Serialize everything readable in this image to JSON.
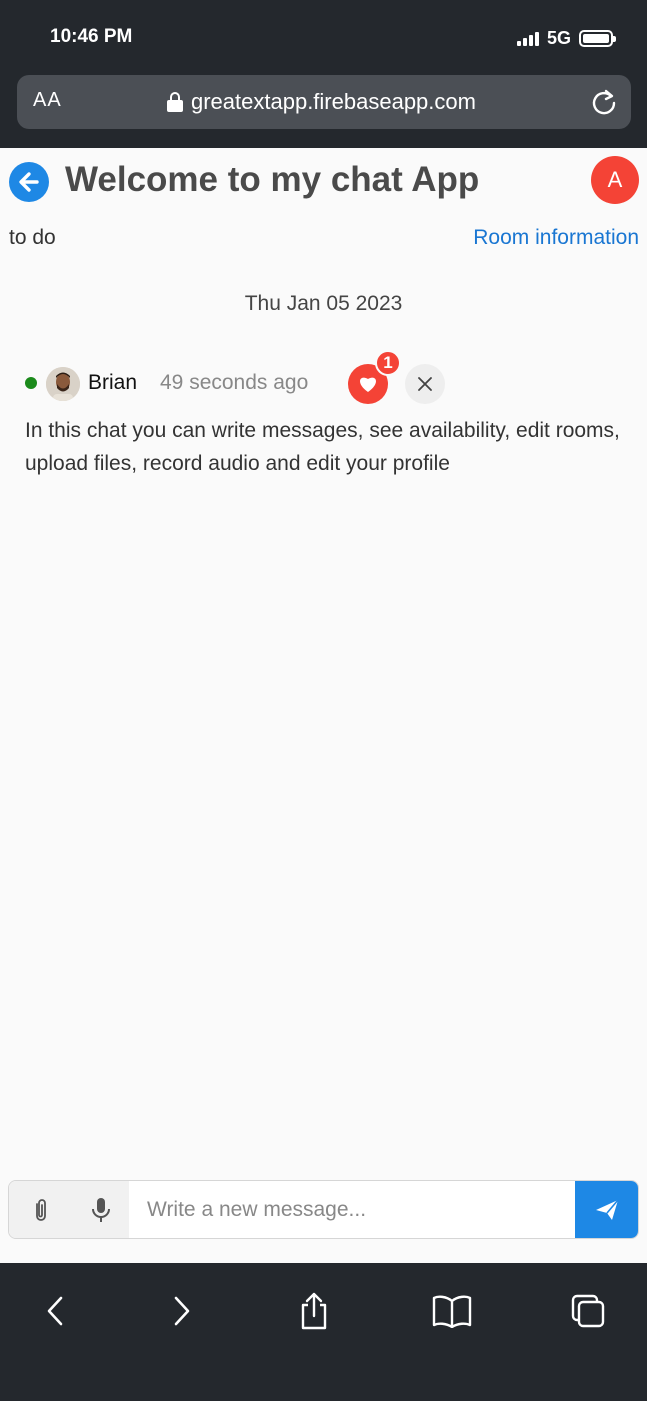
{
  "status": {
    "time": "10:46 PM",
    "network": "5G"
  },
  "browser": {
    "text_size_label": "AA",
    "url": "greatextapp.firebaseapp.com"
  },
  "header": {
    "title": "Welcome to my chat App",
    "user_initial": "A"
  },
  "room": {
    "name": "to do",
    "info_link": "Room information"
  },
  "chat": {
    "date": "Thu Jan 05 2023",
    "messages": [
      {
        "author": "Brian",
        "time": "49 seconds ago",
        "likes": "1",
        "text": "In this chat you can write messages, see availability, edit rooms, upload files, record audio and edit your profile"
      }
    ]
  },
  "composer": {
    "placeholder": "Write a new message..."
  },
  "colors": {
    "accent": "#1e88e5",
    "danger": "#f44336",
    "online": "#1b8a1b",
    "chrome": "#24282d"
  },
  "icons": {
    "back": "arrow-left-circle-icon",
    "like": "heart-icon",
    "close": "close-icon",
    "attach": "paperclip-icon",
    "mic": "microphone-icon",
    "send": "send-icon",
    "toolbar": [
      "chevron-left-icon",
      "chevron-right-icon",
      "share-icon",
      "bookmarks-icon",
      "tabs-icon"
    ]
  }
}
